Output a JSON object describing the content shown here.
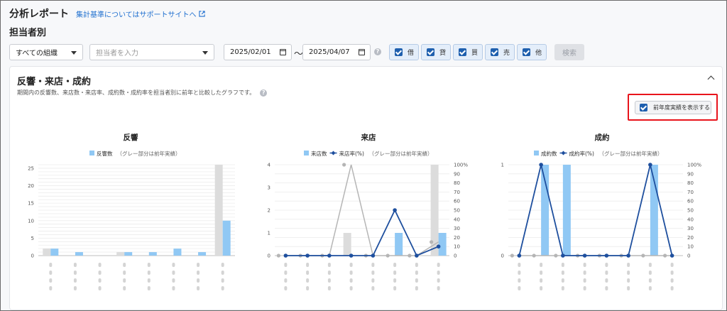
{
  "header": {
    "title": "分析レポート",
    "help_link": "集計基準についてはサポートサイトへ",
    "subtitle": "担当者別"
  },
  "filters": {
    "organization": "すべての組織",
    "staff_placeholder": "担当者を入力",
    "date_from": "2025/02/01",
    "tilde": "〜",
    "date_to": "2025/04/07",
    "help": "?",
    "toggles": [
      {
        "label": "借",
        "checked": true
      },
      {
        "label": "貸",
        "checked": true
      },
      {
        "label": "買",
        "checked": true
      },
      {
        "label": "売",
        "checked": true
      },
      {
        "label": "他",
        "checked": true
      }
    ],
    "search_label": "検索"
  },
  "card": {
    "title": "反響・来店・成約",
    "description": "期間内の反響数、来店数・来店率、成約数・成約率を担当者別に前年と比較したグラフです。",
    "help": "?",
    "prev_year_label": "前年度実績を表示する",
    "prev_year_checked": true
  },
  "colors": {
    "accent": "#1e5fae",
    "bar_current": "#90c8f4",
    "bar_previous": "#dcdcdc",
    "line_current": "#1e4f9e",
    "line_previous": "#b5b5b5",
    "highlight": "#e8141c"
  },
  "chart_data": [
    {
      "type": "bar",
      "title": "反響",
      "legend": [
        {
          "name": "反響数"
        }
      ],
      "legend_note": "（グレー部分は前年実績）",
      "categories": [
        "",
        "",
        "",
        "",
        "",
        "",
        "",
        ""
      ],
      "series": [
        {
          "name": "反響数",
          "values": [
            2,
            1,
            0,
            1,
            1,
            2,
            1,
            10
          ]
        },
        {
          "name": "",
          "values": [
            2,
            0,
            0,
            1,
            0,
            0,
            0,
            26
          ]
        }
      ],
      "y_ticks": [
        "0",
        "5",
        "10",
        "15",
        "20",
        "25"
      ],
      "ylim": [
        0,
        26
      ]
    },
    {
      "type": "bar",
      "title": "来店",
      "legend": [
        {
          "name": "来店数"
        },
        {
          "name": "来店率(%)"
        }
      ],
      "legend_note": "（グレー部分は前年実績）",
      "categories": [
        "",
        "",
        "",
        "",
        "",
        "",
        "",
        ""
      ],
      "series": [
        {
          "name": "来店数",
          "values": [
            0,
            0,
            0,
            0,
            0,
            1,
            0,
            1
          ]
        },
        {
          "name": "",
          "values": [
            0,
            0,
            0,
            1,
            0,
            0,
            0,
            4
          ]
        },
        {
          "name": "来店率(%)",
          "values": [
            0,
            0,
            0,
            0,
            0,
            50,
            0,
            10
          ]
        },
        {
          "name": "",
          "values": [
            0,
            0,
            0,
            100,
            0,
            0,
            0,
            15
          ]
        }
      ],
      "y_ticks": [
        "0",
        "1",
        "2",
        "3",
        "4"
      ],
      "y2_ticks": [
        "0",
        "10",
        "20",
        "30",
        "40",
        "50",
        "60",
        "70",
        "80",
        "90",
        "100%"
      ],
      "ylim": [
        0,
        4
      ],
      "y2lim": [
        0,
        100
      ]
    },
    {
      "type": "bar",
      "title": "成約",
      "legend": [
        {
          "name": "成約数"
        },
        {
          "name": "成約率(%)"
        }
      ],
      "legend_note": "（グレー部分は前年実績）",
      "categories": [
        "",
        "",
        "",
        "",
        "",
        "",
        "",
        ""
      ],
      "series": [
        {
          "name": "成約数",
          "values": [
            0,
            1,
            1,
            0,
            0,
            0,
            1,
            0
          ]
        },
        {
          "name": "",
          "values": [
            0,
            0,
            0,
            0,
            0,
            0,
            0,
            0
          ]
        },
        {
          "name": "成約率(%)",
          "values": [
            0,
            100,
            0,
            0,
            0,
            0,
            100,
            0
          ]
        },
        {
          "name": "",
          "values": [
            0,
            0,
            0,
            0,
            0,
            0,
            0,
            0
          ]
        }
      ],
      "y_ticks": [
        "0",
        "1"
      ],
      "y2_ticks": [
        "0",
        "10",
        "20",
        "30",
        "40",
        "50",
        "60",
        "70",
        "80",
        "90",
        "100%"
      ],
      "ylim": [
        0,
        1
      ],
      "y2lim": [
        0,
        100
      ]
    }
  ]
}
